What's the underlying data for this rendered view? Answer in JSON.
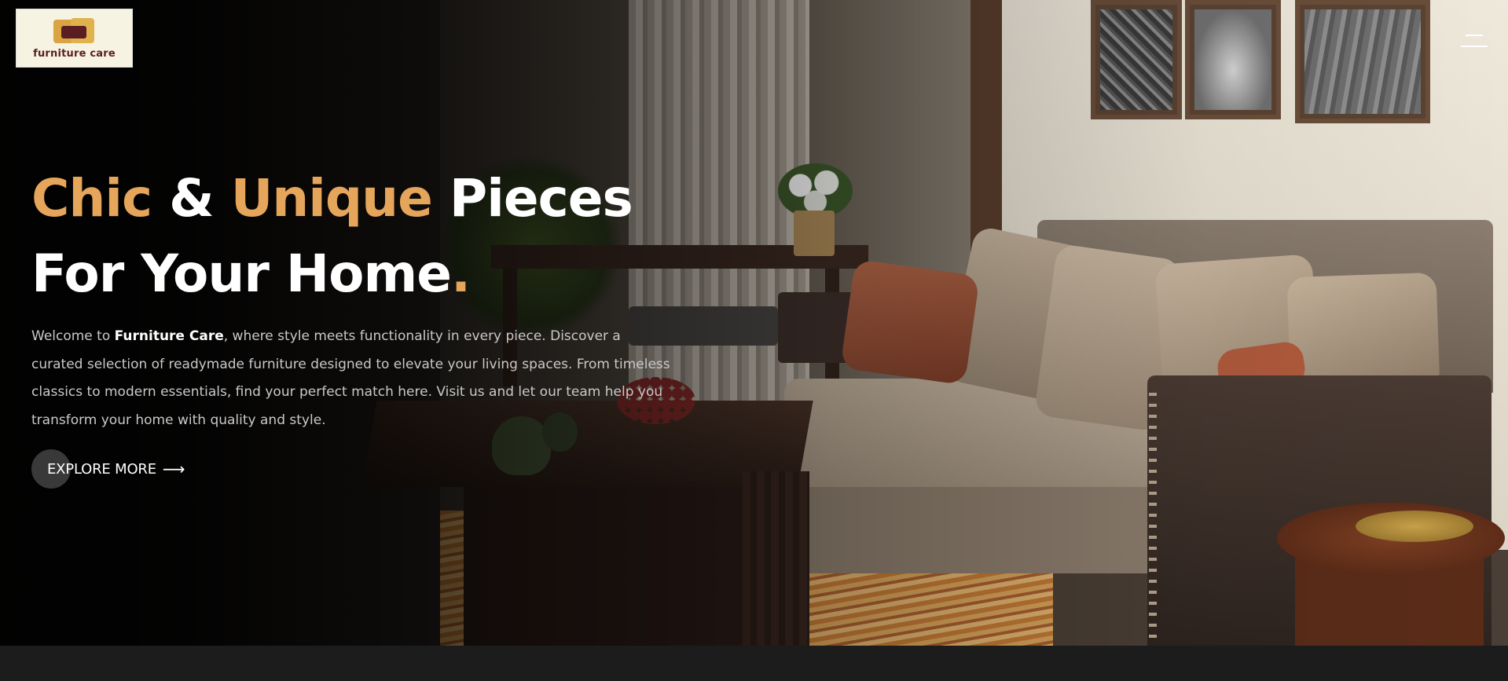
{
  "brand": {
    "logo_text": "furniture care"
  },
  "nav": {
    "menu_icon": "hamburger-menu-icon"
  },
  "hero": {
    "headline": {
      "word1": "Chic",
      "amp": "&",
      "word2": "Unique",
      "word3": "Pieces",
      "line2": "For Your Home",
      "dot": "."
    },
    "description": {
      "intro": "Welcome to",
      "brand": "Furniture Care",
      "rest": ", where style meets functionality in every piece. Discover a curated selection of readymade furniture designed to elevate your living spaces. From timeless classics to modern essentials, find your perfect match here. Visit us and let our team help you transform your home with quality and style."
    },
    "cta_label": "EXPLORE MORE",
    "cta_icon": "arrow-right-icon"
  },
  "colors": {
    "accent": "#e5a55a",
    "text": "#ffffff",
    "body_text": "#c9c9c9",
    "footer": "#1c1c1c"
  }
}
